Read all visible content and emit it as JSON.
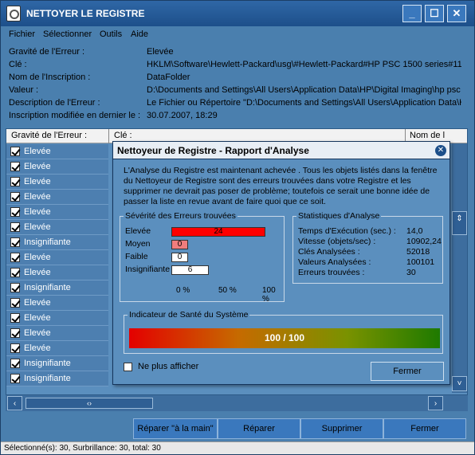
{
  "window": {
    "title": "NETTOYER LE REGISTRE",
    "minimize": "_",
    "maximize": "☐",
    "close": "✕"
  },
  "menu": [
    "Fichier",
    "Sélectionner",
    "Outils",
    "Aide"
  ],
  "details": [
    {
      "label": "Gravité de l'Erreur :",
      "value": "Elevée"
    },
    {
      "label": "Clé :",
      "value": "HKLM\\Software\\Hewlett-Packard\\usg\\#Hewlett-Packard#HP PSC 1500 series#11"
    },
    {
      "label": "Nom de l'Inscription :",
      "value": "DataFolder"
    },
    {
      "label": "Valeur :",
      "value": "D:\\Documents and Settings\\All Users\\Application Data\\HP\\Digital Imaging\\hp psc"
    },
    {
      "label": "Description de l'Erreur :",
      "value": "Le Fichier ou Répertoire \"D:\\Documents and Settings\\All Users\\Application Data\\H"
    },
    {
      "label": "Inscription modifiée en dernier le :",
      "value": "30.07.2007, 18:29"
    }
  ],
  "grid": {
    "headers": [
      "Gravité de l'Erreur :",
      "Clé :",
      "Nom de l"
    ],
    "rows": [
      "Elevée",
      "Elevée",
      "Elevée",
      "Elevée",
      "Elevée",
      "Elevée",
      "Insignifiante",
      "Elevée",
      "Elevée",
      "Insignifiante",
      "Elevée",
      "Elevée",
      "Elevée",
      "Elevée",
      "Insignifiante",
      "Insignifiante"
    ]
  },
  "buttons": {
    "repair_manual": "Réparer \"à la main\"",
    "repair": "Réparer",
    "delete": "Supprimer",
    "close": "Fermer"
  },
  "status": "Sélectionné(s): 30, Surbrillance: 30, total: 30",
  "dialog": {
    "title": "Nettoyeur de Registre - Rapport d'Analyse",
    "close": "✕",
    "message": "L'Analyse du Registre est maintenant achevée . Tous les objets listés dans la fenêtre du Nettoyeur de Registre sont des erreurs trouvées dans votre Registre et les supprimer ne devrait pas poser de problème; toutefois ce serait une bonne idée de passer la liste en revue avant de faire quoi que ce soit.",
    "severity": {
      "title": "Sévérité des Erreurs trouvées",
      "items": [
        {
          "label": "Elevée",
          "count": "24",
          "fraction": 1.0,
          "color": "#ff0000"
        },
        {
          "label": "Moyen",
          "count": "0",
          "fraction": 0.18,
          "color": "#f07d7d"
        },
        {
          "label": "Faible",
          "count": "0",
          "fraction": 0.18,
          "color": "#ffffff"
        },
        {
          "label": "Insignifiante",
          "count": "6",
          "fraction": 0.4,
          "color": "#ffffff"
        }
      ],
      "scale": [
        "0 %",
        "50 %",
        "100 %"
      ]
    },
    "stats": {
      "title": "Statistiques d'Analyse",
      "items": [
        {
          "label": "Temps d'Exécution (sec.) :",
          "value": "14,0"
        },
        {
          "label": "Vitesse (objets/sec) :",
          "value": "10902,24"
        },
        {
          "label": "Clés Analysées :",
          "value": "52018"
        },
        {
          "label": "Valeurs Analysées :",
          "value": "100101"
        },
        {
          "label": "Erreurs trouvées :",
          "value": "30"
        }
      ]
    },
    "health": {
      "title": "Indicateur de Santé du Système",
      "value": "100 / 100"
    },
    "no_show": "Ne plus afficher",
    "close_button": "Fermer"
  }
}
